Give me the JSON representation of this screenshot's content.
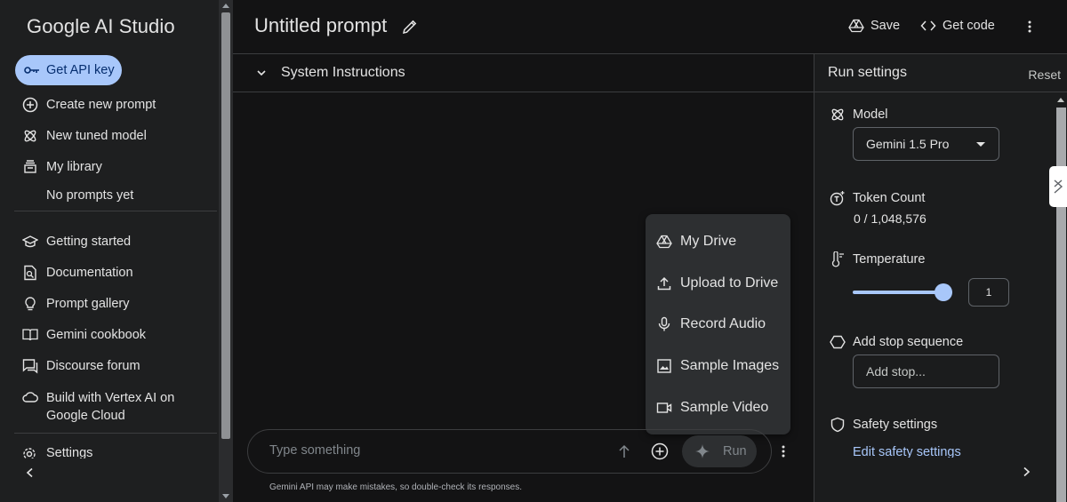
{
  "sidebar": {
    "brand": "Google AI Studio",
    "api_key_label": "Get API key",
    "items": [
      {
        "label": "Create new prompt",
        "icon": "add-circle-icon"
      },
      {
        "label": "New tuned model",
        "icon": "tune-icon"
      },
      {
        "label": "My library",
        "icon": "library-icon"
      }
    ],
    "no_prompts": "No prompts yet",
    "links": [
      {
        "label": "Getting started",
        "icon": "school-icon"
      },
      {
        "label": "Documentation",
        "icon": "document-icon"
      },
      {
        "label": "Prompt gallery",
        "icon": "lightbulb-icon"
      },
      {
        "label": "Gemini cookbook",
        "icon": "book-icon"
      },
      {
        "label": "Discourse forum",
        "icon": "forum-icon"
      }
    ],
    "vertex": "Build with Vertex AI on Google Cloud",
    "settings": "Settings"
  },
  "header": {
    "title": "Untitled prompt",
    "save": "Save",
    "get_code": "Get code"
  },
  "main": {
    "system_instructions": "System Instructions",
    "menu": [
      {
        "label": "My Drive",
        "icon": "drive-icon"
      },
      {
        "label": "Upload to Drive",
        "icon": "upload-icon"
      },
      {
        "label": "Record Audio",
        "icon": "mic-icon"
      },
      {
        "label": "Sample Images",
        "icon": "image-icon"
      },
      {
        "label": "Sample Video",
        "icon": "video-icon"
      }
    ],
    "prompt_placeholder": "Type something",
    "run": "Run",
    "disclaimer": "Gemini API may make mistakes, so double-check its responses."
  },
  "run_settings": {
    "title": "Run settings",
    "reset": "Reset",
    "model_label": "Model",
    "model_value": "Gemini 1.5 Pro",
    "token_label": "Token Count",
    "token_value": "0 / 1,048,576",
    "temperature_label": "Temperature",
    "temperature_value": "1",
    "temperature_slider_fraction": 1.0,
    "stop_label": "Add stop sequence",
    "stop_placeholder": "Add stop...",
    "safety_label": "Safety settings",
    "safety_link": "Edit safety settings"
  },
  "colors": {
    "accent": "#a8c7fa",
    "background": "#131314",
    "sidebar": "#1e1f20"
  }
}
